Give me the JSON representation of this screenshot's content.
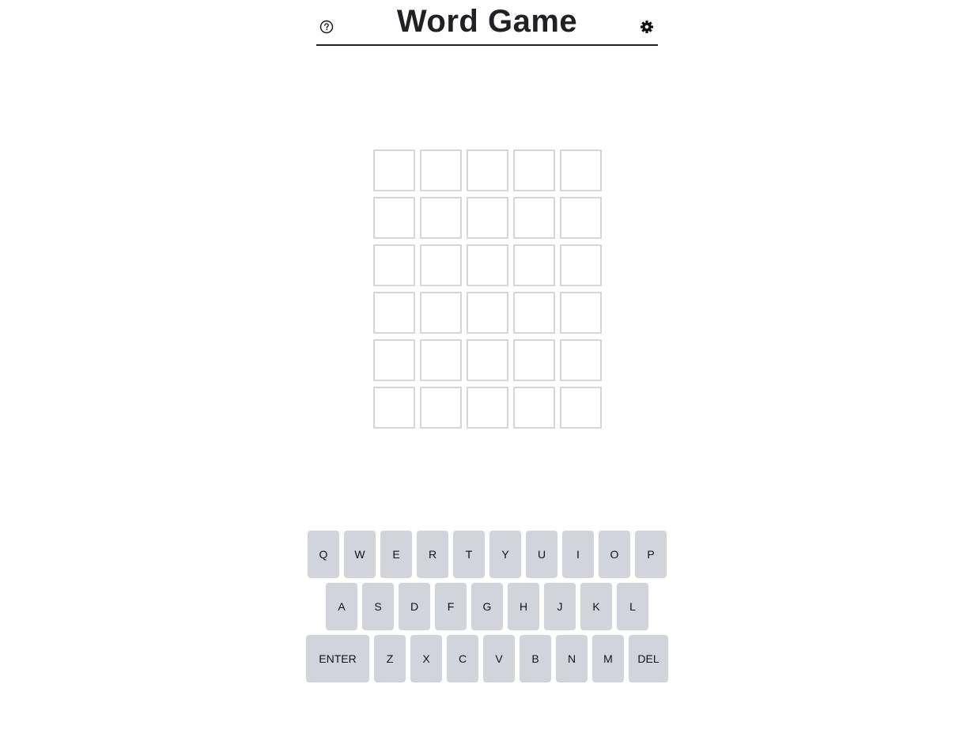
{
  "header": {
    "title": "Word Game",
    "help_icon": "question-circle-icon",
    "settings_icon": "gear-icon"
  },
  "board": {
    "rows": [
      [
        "",
        "",
        "",
        "",
        ""
      ],
      [
        "",
        "",
        "",
        "",
        ""
      ],
      [
        "",
        "",
        "",
        "",
        ""
      ],
      [
        "",
        "",
        "",
        "",
        ""
      ],
      [
        "",
        "",
        "",
        "",
        ""
      ],
      [
        "",
        "",
        "",
        "",
        ""
      ]
    ]
  },
  "keyboard": {
    "rows": [
      [
        "Q",
        "W",
        "E",
        "R",
        "T",
        "Y",
        "U",
        "I",
        "O",
        "P"
      ],
      [
        "A",
        "S",
        "D",
        "F",
        "G",
        "H",
        "J",
        "K",
        "L"
      ],
      [
        "ENTER",
        "Z",
        "X",
        "C",
        "V",
        "B",
        "N",
        "M",
        "DEL"
      ]
    ]
  },
  "colors": {
    "key_bg": "#d1d5db",
    "tile_border": "#d4d6da",
    "text": "#1f2126"
  }
}
